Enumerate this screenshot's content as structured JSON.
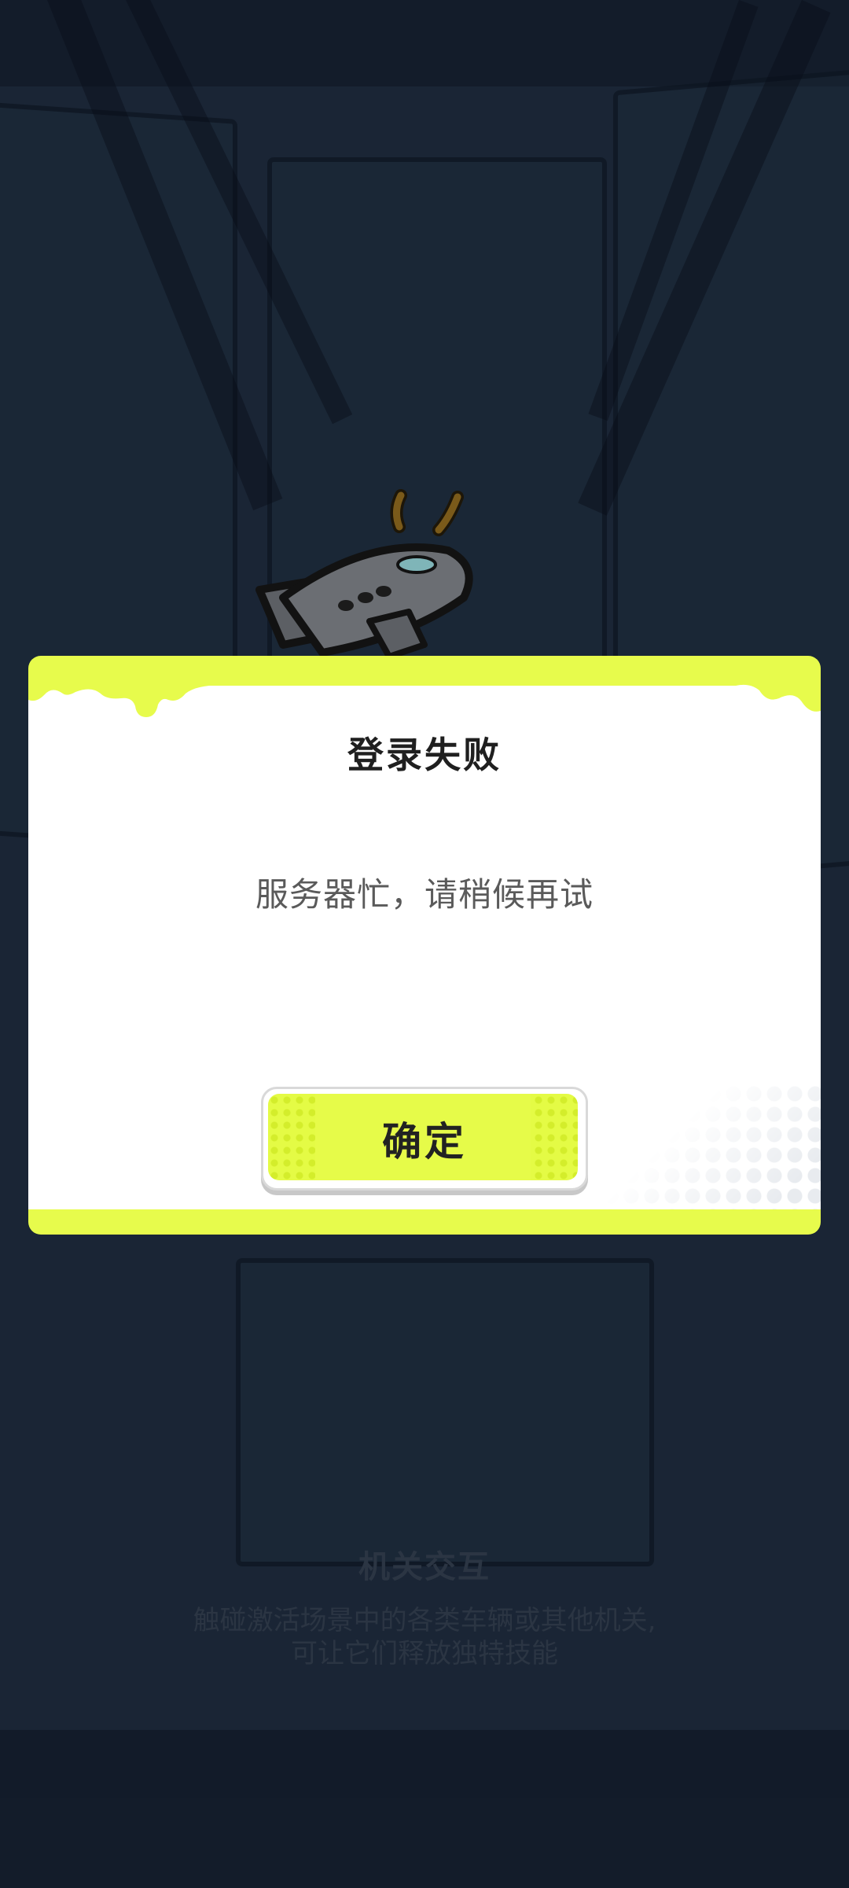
{
  "dialog": {
    "title": "登录失败",
    "message": "服务器忙，请稍候再试",
    "confirm_label": "确定"
  },
  "background_tip": {
    "title": "机关交互",
    "line1": "触碰激活场景中的各类车辆或其他机关,",
    "line2": "可让它们释放独特技能"
  },
  "colors": {
    "background": "#1a2535",
    "accent": "#e7fb4c",
    "dialog_bg": "#ffffff",
    "title_text": "#1f1f1f",
    "message_text": "#5a5a5a"
  },
  "icons": {
    "illustration": "airplane-icon"
  }
}
